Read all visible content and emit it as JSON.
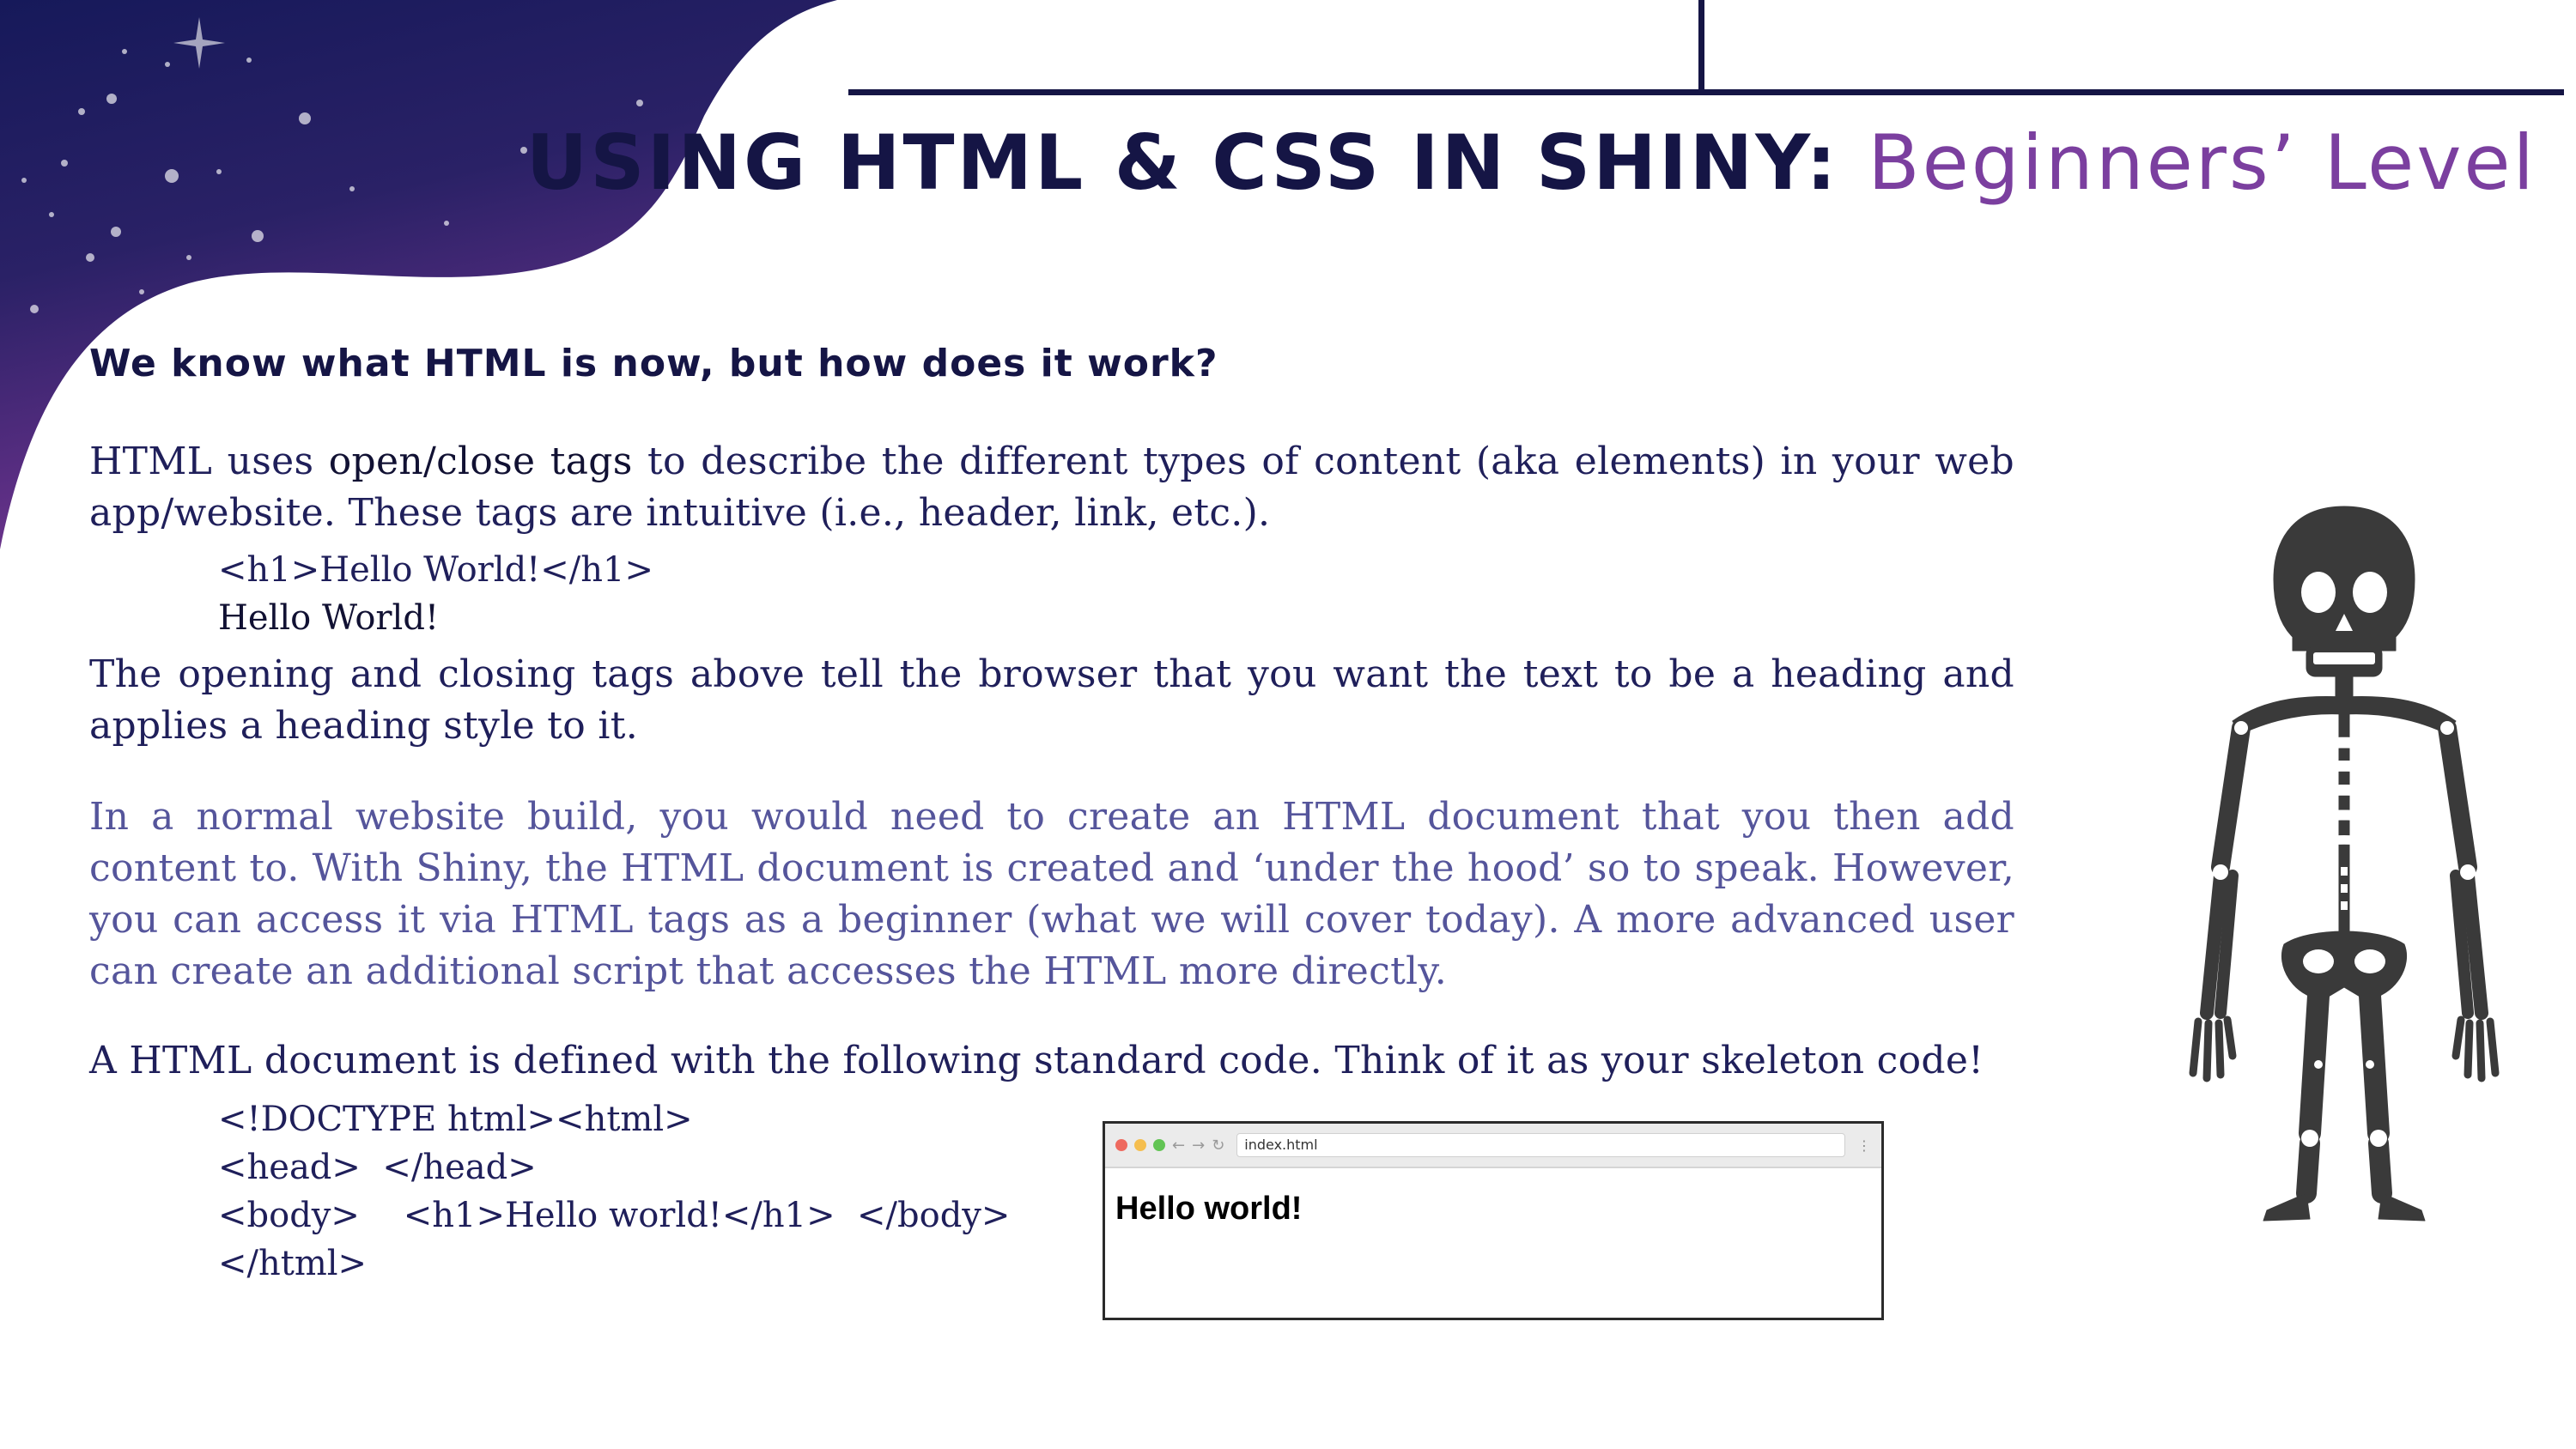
{
  "header": {
    "title_main": "USING HTML & CSS IN SHINY:",
    "title_accent": "Beginners’ Level"
  },
  "section_heading": "We know what HTML is now, but how does it work?",
  "paragraph_1": {
    "before": "HTML uses ",
    "emphasis": "open/close tags",
    "after": " to describe the different types of content (aka elements) in your web app/website. These tags are intuitive (i.e., header, link, etc.)."
  },
  "example_code": "<h1>Hello World!</h1>",
  "example_output": "Hello World!",
  "paragraph_2": "The opening and closing tags above tell the browser that you want the text to be a heading and applies a heading style to it.",
  "paragraph_3": "In a normal website build, you would need to create an HTML document that you then add content to. With Shiny, the HTML document is created and ‘under the hood’ so to speak. However, you can access it via HTML tags as a beginner (what we will cover today). A more advanced user can create an additional script that accesses the HTML more directly.",
  "paragraph_4": "A HTML document is defined with the following standard code. Think of it as your skeleton code!",
  "skeleton_code": [
    "<!DOCTYPE html><html>",
    "<head>  </head>",
    "<body>    <h1>Hello world!</h1>  </body>",
    "</html>"
  ],
  "browser": {
    "address": "index.html",
    "menu_glyph": "⋮",
    "back_glyph": "←",
    "forward_glyph": "→",
    "reload_glyph": "↻",
    "heading": "Hello world!",
    "dot_colors": [
      "#ee6a5f",
      "#f5be4f",
      "#62c454"
    ]
  },
  "colors": {
    "navy": "#151545",
    "accent_purple": "#7b3f9f",
    "muted_text": "#55559b"
  },
  "icons": {
    "skeleton": "skeleton-illustration",
    "corner": "starry-night-corner"
  }
}
